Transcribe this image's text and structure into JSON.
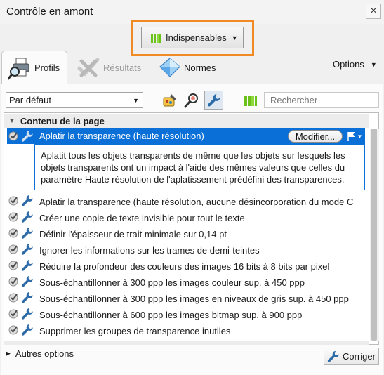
{
  "window": {
    "title": "Contrôle en amont",
    "close_glyph": "×"
  },
  "profile_dropdown": {
    "label": "Indispensables",
    "icon": "library-books-icon",
    "accent_color": "#6cc01a",
    "highlight_color": "#f08a24"
  },
  "tabs": [
    {
      "label": "Profils",
      "icon": "printer-magnifier-icon",
      "active": true
    },
    {
      "label": "Résultats",
      "icon": "check-cross-icon",
      "active": false
    },
    {
      "label": "Normes",
      "icon": "diamond-icon",
      "active": false
    }
  ],
  "options_menu": {
    "label": "Options"
  },
  "toolbar": {
    "preset_value": "Par défaut",
    "search_placeholder": "Rechercher"
  },
  "group": {
    "label": "Contenu de la page"
  },
  "selected_item": {
    "label": "Aplatir la transparence (haute résolution)",
    "modify_label": "Modifier...",
    "description": "Aplatit tous les objets transparents de même que les objets sur lesquels les objets transparents ont un impact à l'aide des mêmes valeurs que celles du paramètre Haute résolution de l'aplatissement prédéfini des transparences.",
    "selection_color": "#0a6fd6"
  },
  "items": [
    {
      "label": "Aplatir la transparence (haute résolution, aucune désincorporation du mode C"
    },
    {
      "label": "Créer une copie de texte invisible pour tout le texte"
    },
    {
      "label": "Définir l'épaisseur de trait minimale sur 0,14 pt"
    },
    {
      "label": "Ignorer les informations sur les trames de demi-teintes"
    },
    {
      "label": "Réduire la profondeur des couleurs des images 16 bits à 8 bits par pixel"
    },
    {
      "label": "Sous-échantillonner à 300 ppp les images couleur sup. à 450 ppp"
    },
    {
      "label": "Sous-échantillonner à 300 ppp les images en niveaux de gris sup. à 450 ppp"
    },
    {
      "label": "Sous-échantillonner à 600 ppp les images bitmap sup. à 900 ppp"
    },
    {
      "label": "Supprimer les groupes de transparence inutiles"
    }
  ],
  "bottom": {
    "more_options_label": "Autres options",
    "fix_label": "Corriger"
  }
}
